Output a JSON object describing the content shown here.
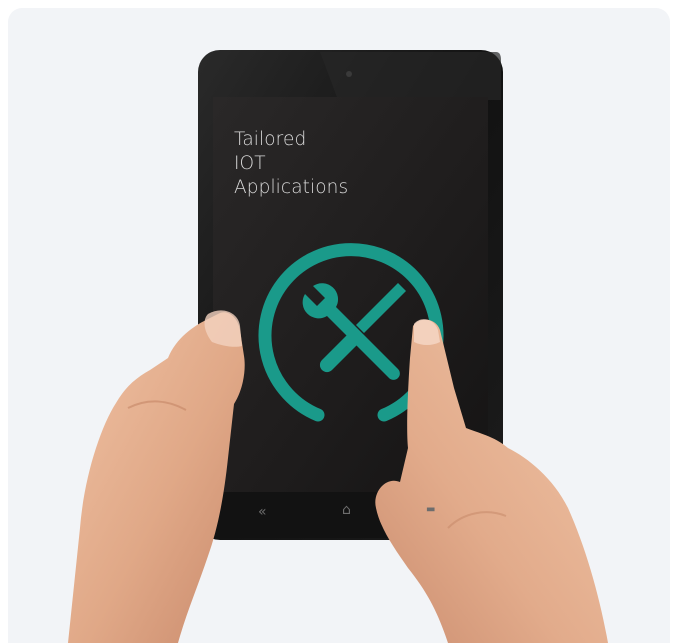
{
  "tablet": {
    "title_lines": [
      "Tailored",
      "IOT",
      "Applications"
    ],
    "icon": "wrench-screwdriver-icon",
    "nav": {
      "back": "«",
      "home": "⌂",
      "menu": "▬"
    }
  },
  "colors": {
    "background": "#f2f4f7",
    "bezel": "#151515",
    "screen": "#1f1d1d",
    "accent": "#1a9a8a",
    "skin": "#e3ae8e"
  }
}
